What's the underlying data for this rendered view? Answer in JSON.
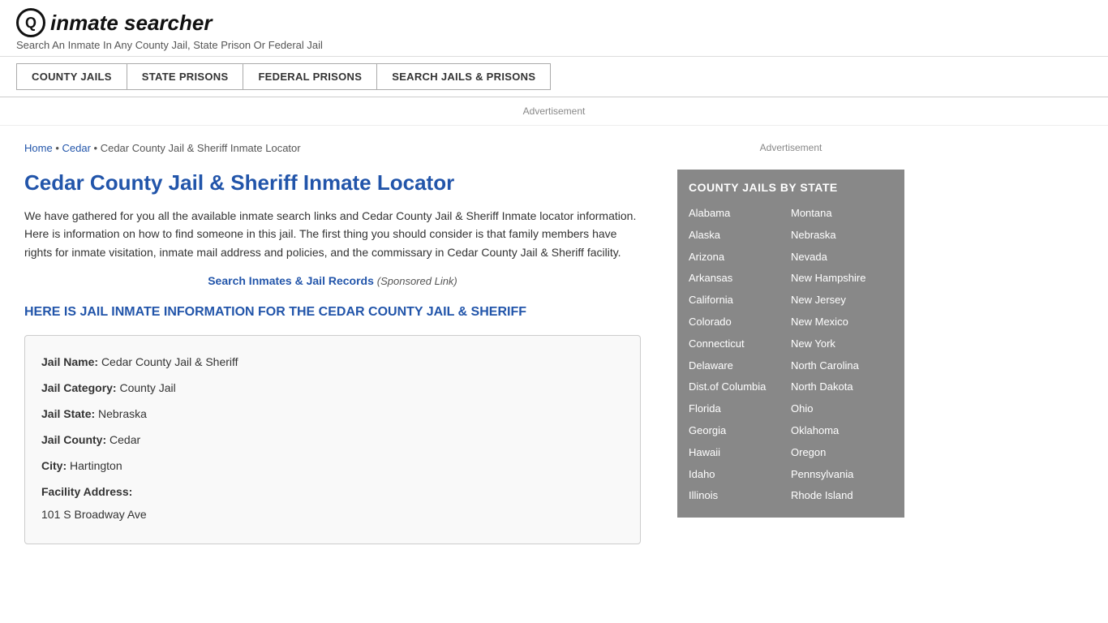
{
  "header": {
    "logo_letter": "Q",
    "logo_text": "inmate searcher",
    "tagline": "Search An Inmate In Any County Jail, State Prison Or Federal Jail"
  },
  "nav": {
    "items": [
      {
        "id": "county-jails",
        "label": "COUNTY JAILS"
      },
      {
        "id": "state-prisons",
        "label": "STATE PRISONS"
      },
      {
        "id": "federal-prisons",
        "label": "FEDERAL PRISONS"
      },
      {
        "id": "search-jails",
        "label": "SEARCH JAILS & PRISONS"
      }
    ]
  },
  "ad": {
    "label": "Advertisement"
  },
  "breadcrumb": {
    "home": "Home",
    "cedar": "Cedar",
    "current": "Cedar County Jail & Sheriff Inmate Locator"
  },
  "content": {
    "title": "Cedar County Jail & Sheriff Inmate Locator",
    "description": "We have gathered for you all the available inmate search links and Cedar County Jail & Sheriff Inmate locator information. Here is information on how to find someone in this jail. The first thing you should consider is that family members have rights for inmate visitation, inmate mail address and policies, and the commissary in Cedar County Jail & Sheriff facility.",
    "sponsored_link_text": "Search Inmates & Jail Records",
    "sponsored_suffix": "(Sponsored Link)",
    "inmate_heading": "HERE IS JAIL INMATE INFORMATION FOR THE CEDAR COUNTY JAIL & SHERIFF"
  },
  "info_box": {
    "jail_name_label": "Jail Name:",
    "jail_name_value": "Cedar County Jail & Sheriff",
    "jail_category_label": "Jail Category:",
    "jail_category_value": "County Jail",
    "jail_state_label": "Jail State:",
    "jail_state_value": "Nebraska",
    "jail_county_label": "Jail County:",
    "jail_county_value": "Cedar",
    "city_label": "City:",
    "city_value": "Hartington",
    "address_label": "Facility Address:",
    "address_value": "101 S Broadway Ave"
  },
  "sidebar": {
    "ad_label": "Advertisement",
    "state_box_title": "COUNTY JAILS BY STATE",
    "states_left": [
      "Alabama",
      "Alaska",
      "Arizona",
      "Arkansas",
      "California",
      "Colorado",
      "Connecticut",
      "Delaware",
      "Dist.of Columbia",
      "Florida",
      "Georgia",
      "Hawaii",
      "Idaho",
      "Illinois"
    ],
    "states_right": [
      "Montana",
      "Nebraska",
      "Nevada",
      "New Hampshire",
      "New Jersey",
      "New Mexico",
      "New York",
      "North Carolina",
      "North Dakota",
      "Ohio",
      "Oklahoma",
      "Oregon",
      "Pennsylvania",
      "Rhode Island"
    ]
  }
}
